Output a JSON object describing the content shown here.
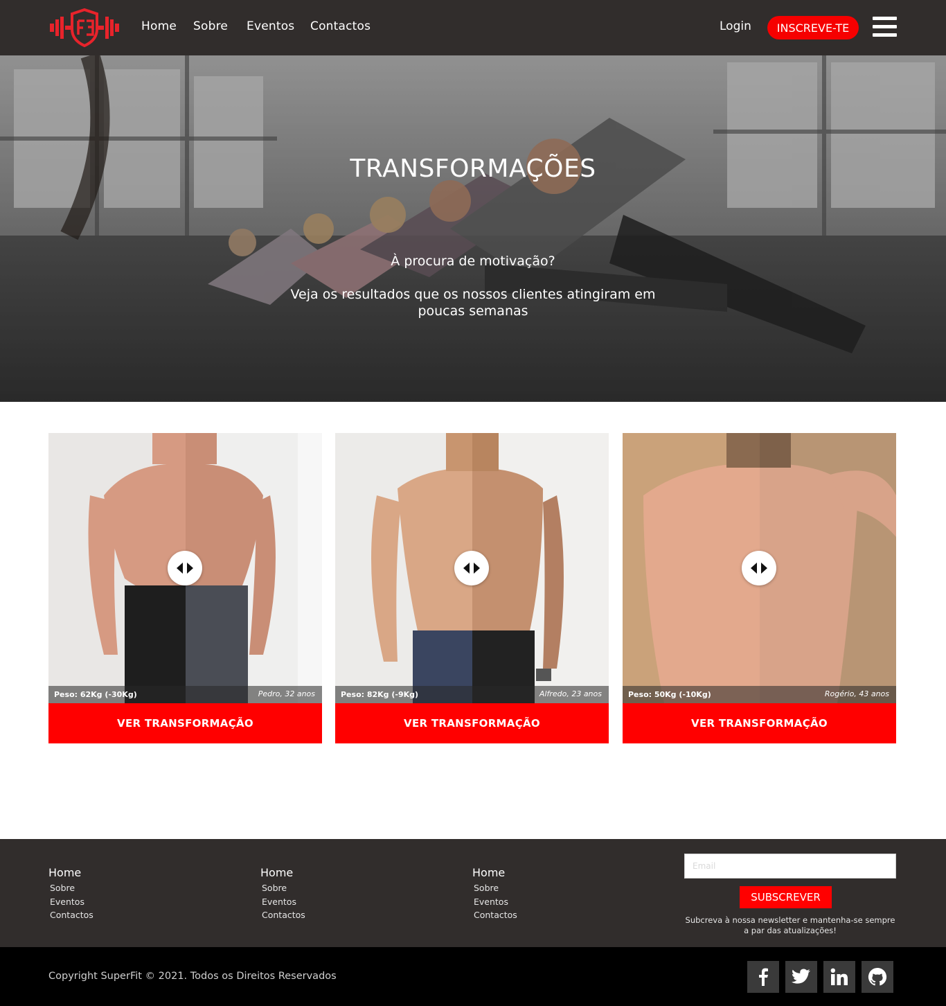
{
  "header": {
    "nav": [
      "Home",
      "Sobre",
      "Eventos",
      "Contactos"
    ],
    "login": "Login",
    "signup": "INSCREVE-TE"
  },
  "hero": {
    "title": "TRANSFORMAÇÕES",
    "subtitle1": "À procura de motivação?",
    "subtitle2": "Veja os resultados que os nossos clientes atingiram em poucas semanas"
  },
  "cards": [
    {
      "weight": "Peso:  62Kg (-30Kg)",
      "who": "Pedro, 32 anos",
      "button": "VER TRANSFORMAÇÃO"
    },
    {
      "weight": "Peso:  82Kg (-9Kg)",
      "who": "Alfredo, 23 anos",
      "button": "VER TRANSFORMAÇÃO"
    },
    {
      "weight": "Peso:  50Kg (-10Kg)",
      "who": "Rogério, 43 anos",
      "button": "VER TRANSFORMAÇÃO"
    }
  ],
  "footer": {
    "columns": [
      {
        "heading": "Home",
        "links": [
          "Sobre",
          "Eventos",
          "Contactos"
        ]
      },
      {
        "heading": "Home",
        "links": [
          "Sobre",
          "Eventos",
          "Contactos"
        ]
      },
      {
        "heading": "Home",
        "links": [
          "Sobre",
          "Eventos",
          "Contactos"
        ]
      }
    ],
    "email_placeholder": "Email",
    "subscribe": "SUBSCREVER",
    "newsletter": "Subcreva à nossa newsletter e mantenha-se sempre a par das atualizações!",
    "copyright": "Copyright SuperFit © 2021. Todos os Direitos Reservados",
    "social": [
      "facebook-icon",
      "twitter-icon",
      "linkedin-icon",
      "github-icon"
    ]
  },
  "colors": {
    "accent": "#ff0000",
    "header_bg": "#312d2c",
    "footer_bottom": "#000000"
  }
}
